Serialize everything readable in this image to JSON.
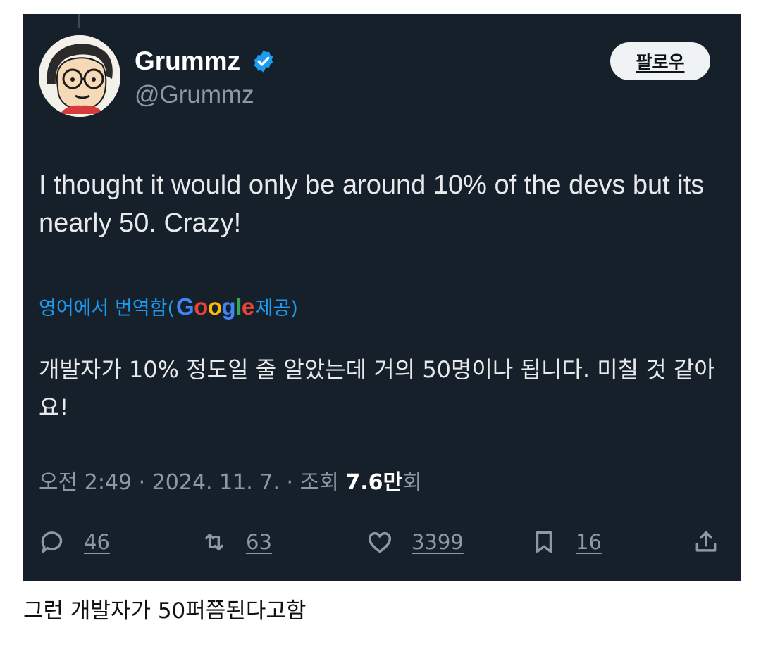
{
  "tweet": {
    "author_name": "Grummz",
    "handle": "@Grummz",
    "follow_label": "팔로우",
    "text_en": "I thought it would only be around 10% of the devs but its nearly 50. Crazy!",
    "translate_prefix": "영어에서 번역함(",
    "translate_brand": "Google",
    "translate_suffix": " 제공)",
    "text_ko": "개발자가 10% 정도일 줄 알았는데 거의 50명이나 됩니다. 미칠 것 같아요!",
    "meta_prefix": "오전 2:49 · 2024. 11. 7. · 조회 ",
    "views_value": "7.6만",
    "views_suffix": "회"
  },
  "actions": {
    "replies": "46",
    "retweets": "63",
    "likes": "3399",
    "bookmarks": "16"
  },
  "icons": [
    "verified-icon",
    "reply-icon",
    "retweet-icon",
    "like-icon",
    "bookmark-icon",
    "share-icon"
  ],
  "colors": {
    "background": "#15202b",
    "accent": "#1d9bf0",
    "muted": "#8b98a5",
    "google_blue": "#4285f4",
    "google_red": "#ea4335",
    "google_yellow": "#fbbc05",
    "google_green": "#34a853"
  },
  "caption": "그런 개발자가 50퍼쯤된다고함"
}
